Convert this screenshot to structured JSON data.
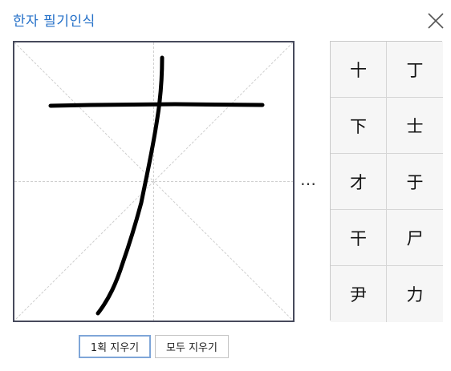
{
  "header": {
    "title": "한자 필기인식",
    "close_icon": "close-icon"
  },
  "drawing_area": {
    "guide_color": "#cfcfcf",
    "ink_color": "#000000",
    "border_color": "#474a5c"
  },
  "more_indicator": "…",
  "candidates": [
    {
      "char": "十"
    },
    {
      "char": "丁"
    },
    {
      "char": "下"
    },
    {
      "char": "士"
    },
    {
      "char": "才"
    },
    {
      "char": "于"
    },
    {
      "char": "干"
    },
    {
      "char": "尸"
    },
    {
      "char": "尹"
    },
    {
      "char": "力"
    }
  ],
  "buttons": {
    "undo_stroke": "1획 지우기",
    "clear_all": "모두 지우기"
  },
  "colors": {
    "accent": "#2470c8",
    "focus_border": "#7fa6d8"
  }
}
